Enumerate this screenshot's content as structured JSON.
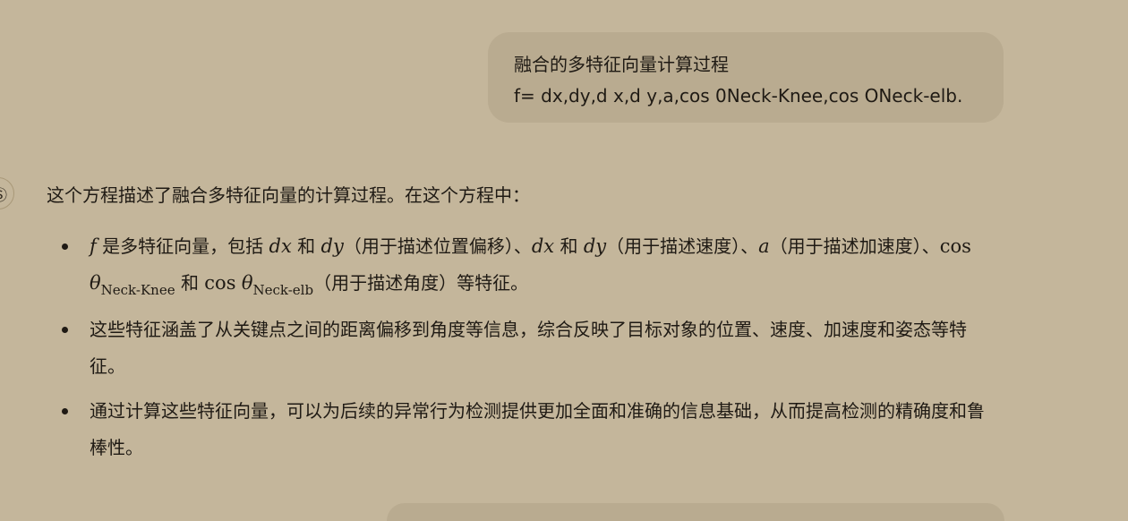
{
  "user_message": {
    "line1": "融合的多特征向量计算过程",
    "line2": "f= dx,dy,d x,d y,a,cos 0Neck-Knee,cos ONeck-elb."
  },
  "assistant": {
    "avatar_glyph": "Ⓢ",
    "intro": "这个方程描述了融合多特征向量的计算过程。在这个方程中：",
    "bullet1": {
      "f": "f",
      "t1": "是多特征向量，包括",
      "dx1": "dx",
      "and1": "和",
      "dy1": "dy",
      "t2": "（用于描述位置偏移）、",
      "dx2": "dx",
      "and2": "和",
      "dy2": "dy",
      "t3": "（用于描述速度）、",
      "a": "a",
      "t4": "（用于描述加速度）、",
      "cos1": "cos",
      "theta1": "θ",
      "sub1": "Neck-Knee",
      "and3": "和",
      "cos2": "cos",
      "theta2": "θ",
      "sub2": "Neck-elb",
      "t5": "（用于描述角度）等特征。"
    },
    "bullet2": "这些特征涵盖了从关键点之间的距离偏移到角度等信息，综合反映了目标对象的位置、速度、加速度和姿态等特征。",
    "bullet3": "通过计算这些特征向量，可以为后续的异常行为检测提供更加全面和准确的信息基础，从而提高检测的精确度和鲁棒性。"
  },
  "colors": {
    "background": "#c4b69b",
    "bubble": "#b9ab90",
    "text": "#1f1a14"
  }
}
